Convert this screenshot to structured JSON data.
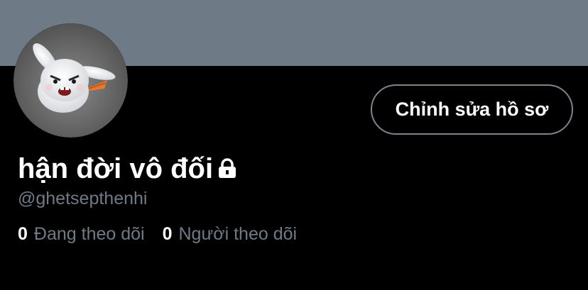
{
  "profile": {
    "display_name": "hận đời vô đối",
    "handle": "@ghetsepthenhi",
    "protected_icon": "lock-icon",
    "avatar_icon": "rabbit-avatar"
  },
  "actions": {
    "edit_profile_label": "Chỉnh sửa hồ sơ"
  },
  "stats": [
    {
      "count": "0",
      "label": "Đang theo dõi"
    },
    {
      "count": "0",
      "label": "Người theo dõi"
    }
  ],
  "colors": {
    "background": "#000000",
    "banner": "#6e7b86",
    "text_primary": "#ffffff",
    "text_secondary": "#6e7b86",
    "button_border": "#7a8590"
  }
}
